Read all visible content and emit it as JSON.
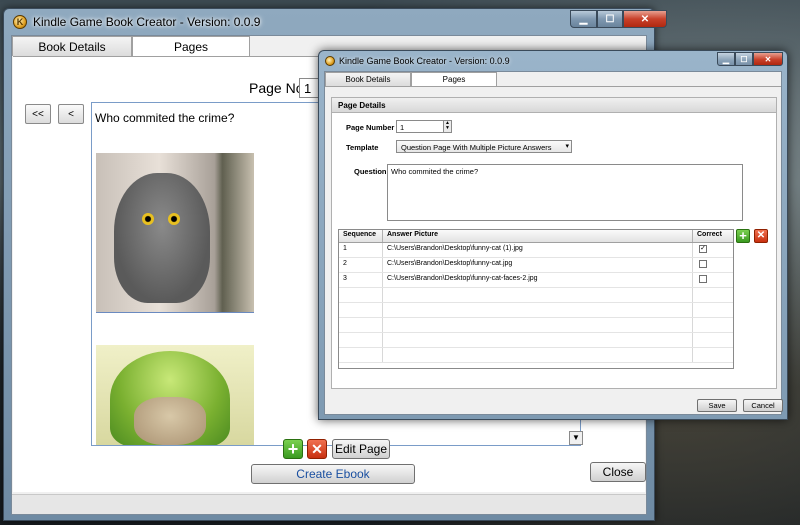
{
  "main_window": {
    "title": "Kindle Game Book Creator - Version: 0.0.9",
    "tabs": [
      {
        "label": "Book Details",
        "active": false
      },
      {
        "label": "Pages",
        "active": true
      }
    ],
    "page_no_label": "Page No:",
    "page_no_value": "1",
    "nav": {
      "first_label": "<<",
      "prev_label": "<"
    },
    "preview": {
      "question_text": "Who commited the crime?",
      "images": [
        "photo-cat-surprised",
        "photo-cat-melon-helmet"
      ]
    },
    "buttons": {
      "add_icon": "plus-icon",
      "delete_icon": "x-icon",
      "edit_page_label": "Edit Page",
      "create_ebook_label": "Create Ebook",
      "close_label": "Close"
    },
    "colors": {
      "create_ebook_text": "#1a4fa0",
      "add_green": "#3a9a20",
      "delete_red": "#c83010"
    }
  },
  "dialog": {
    "title": "Kindle Game Book Creator - Version: 0.0.9",
    "tabs": [
      {
        "label": "Book Details",
        "active": false
      },
      {
        "label": "Pages",
        "active": true
      }
    ],
    "group_title": "Page Details",
    "page_number_label": "Page Number",
    "page_number_value": "1",
    "template_label": "Template",
    "template_value": "Question Page With Multiple Picture Answers",
    "question_label": "Question",
    "question_value": "Who commited the crime?",
    "grid": {
      "columns": [
        "Sequence",
        "Answer Picture",
        "Correct"
      ],
      "rows": [
        {
          "sequence": "1",
          "picture": "C:\\Users\\Brandon\\Desktop\\funny-cat (1).jpg",
          "correct": true
        },
        {
          "sequence": "2",
          "picture": "C:\\Users\\Brandon\\Desktop\\funny-cat.jpg",
          "correct": false
        },
        {
          "sequence": "3",
          "picture": "C:\\Users\\Brandon\\Desktop\\funny-cat-faces-2.jpg",
          "correct": false
        }
      ]
    },
    "save_label": "Save",
    "cancel_label": "Cancel"
  }
}
